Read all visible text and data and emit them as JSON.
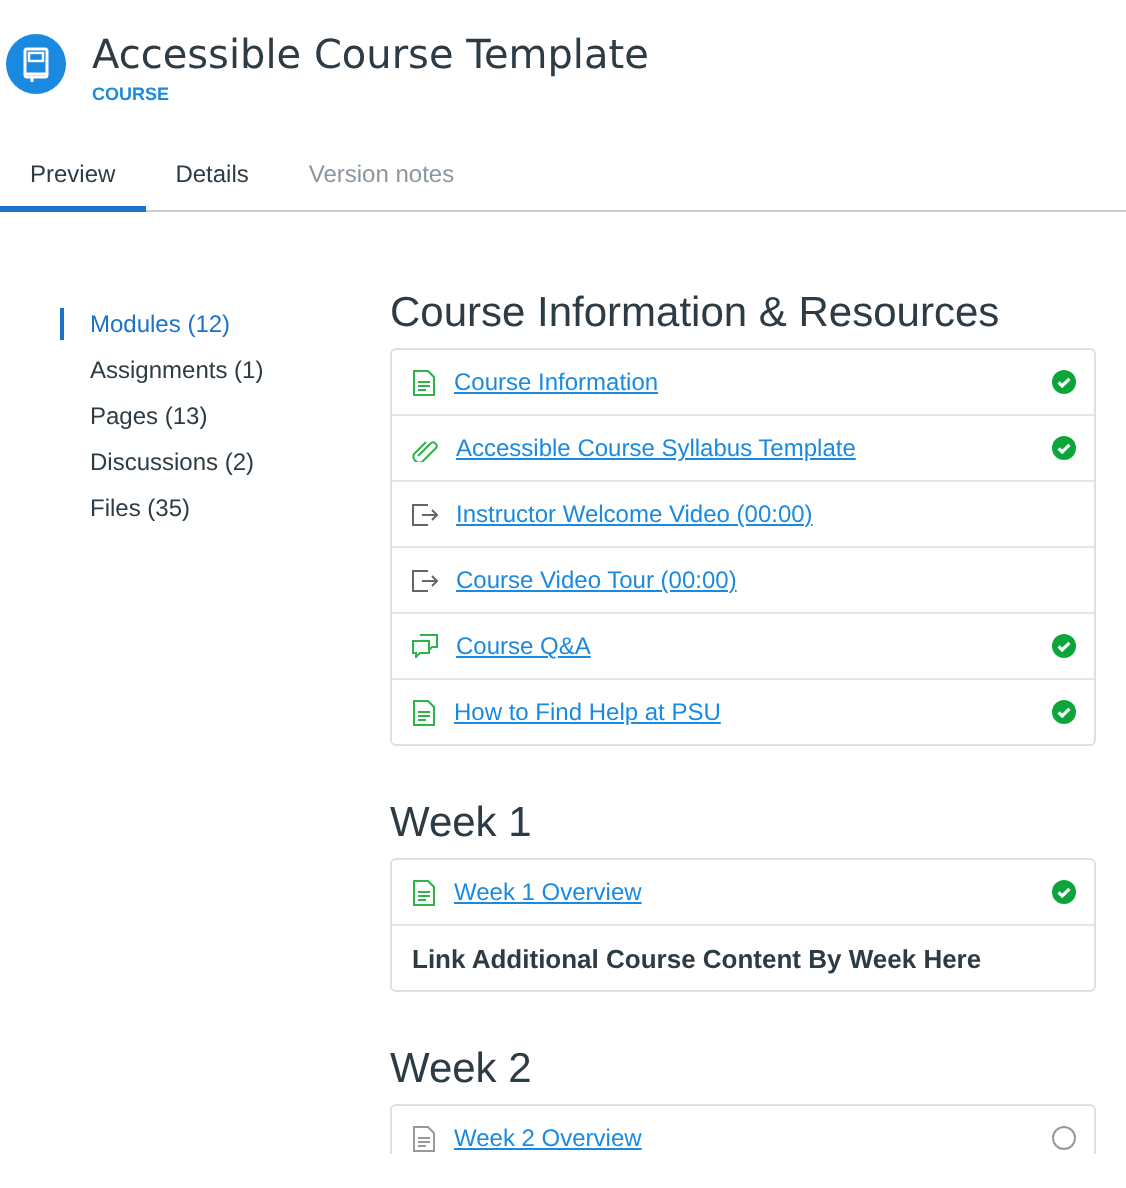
{
  "header": {
    "title": "Accessible Course Template",
    "subtitle": "COURSE"
  },
  "tabs": [
    {
      "label": "Preview",
      "selected": true,
      "disabled": false
    },
    {
      "label": "Details",
      "selected": false,
      "disabled": false
    },
    {
      "label": "Version notes",
      "selected": false,
      "disabled": true
    }
  ],
  "sidebar": {
    "items": [
      {
        "label": "Modules (12)",
        "selected": true
      },
      {
        "label": "Assignments (1)",
        "selected": false
      },
      {
        "label": "Pages (13)",
        "selected": false
      },
      {
        "label": "Discussions (2)",
        "selected": false
      },
      {
        "label": "Files (35)",
        "selected": false
      }
    ]
  },
  "modules": [
    {
      "title": "Course Information & Resources",
      "items": [
        {
          "kind": "page",
          "label": "Course Information",
          "completed": true
        },
        {
          "kind": "attachment",
          "label": "Accessible Course Syllabus Template",
          "completed": true
        },
        {
          "kind": "video",
          "label": "Instructor Welcome Video (00:00)"
        },
        {
          "kind": "video",
          "label": "Course Video Tour (00:00)"
        },
        {
          "kind": "discussion",
          "label": "Course Q&A",
          "completed": true
        },
        {
          "kind": "page",
          "label": "How to Find Help at PSU",
          "completed": true
        }
      ]
    },
    {
      "title": "Week 1",
      "items": [
        {
          "kind": "page",
          "label": "Week 1 Overview",
          "completed": true
        },
        {
          "kind": "header",
          "label": "Link Additional Course Content By Week Here"
        }
      ]
    },
    {
      "title": "Week 2",
      "items": [
        {
          "kind": "page",
          "label": "Week 2 Overview",
          "completed": false
        }
      ]
    }
  ]
}
